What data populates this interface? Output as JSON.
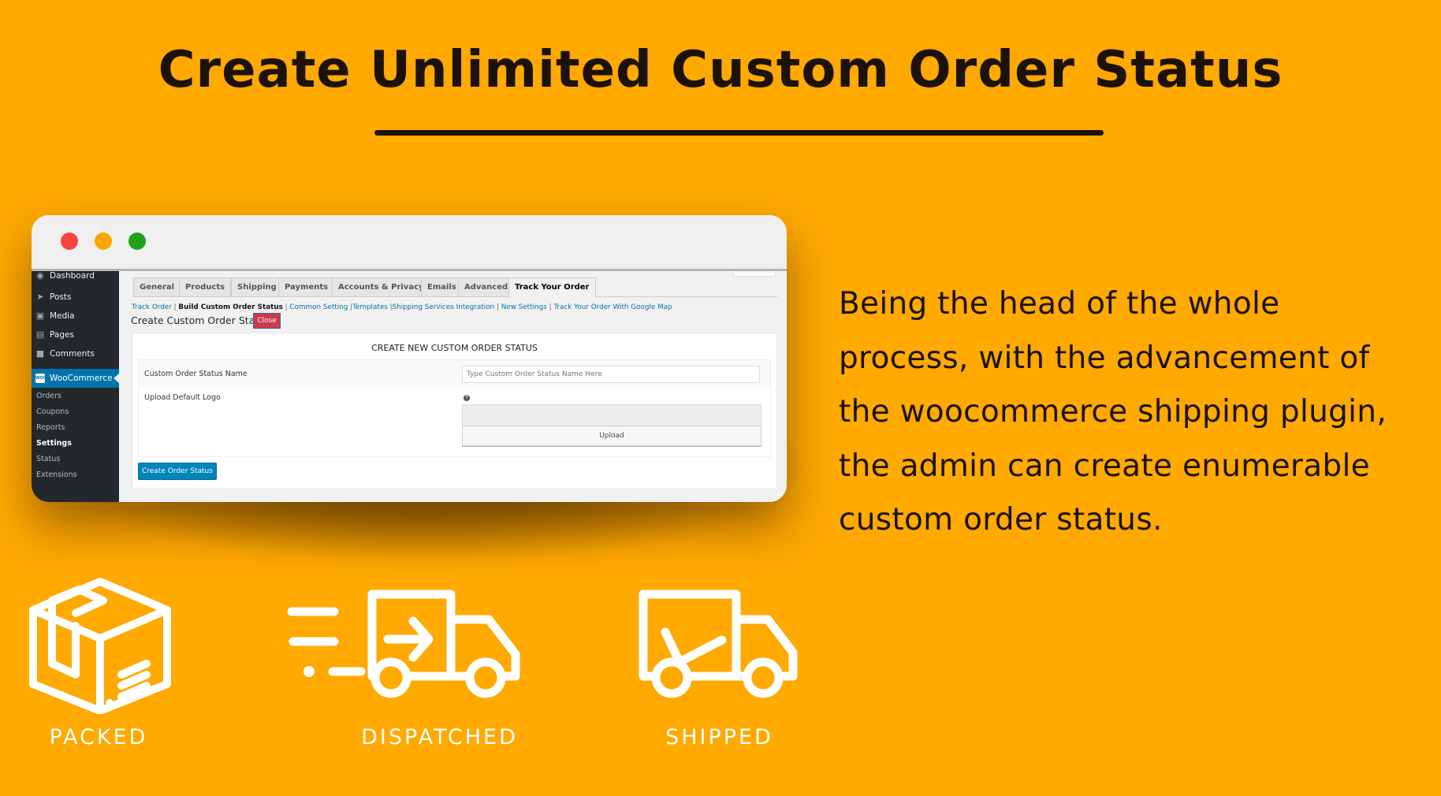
{
  "hero": {
    "title": "Create Unlimited Custom Order Status",
    "description": "Being the head of the whole process, with the advancement of the woocommerce shipping plugin, the admin can create enumerable custom order status.",
    "description_lines": [
      "Being the head of the whole",
      "process, with the advancement of",
      "the woocommerce shipping plugin,",
      "the admin can create enumerable",
      "custom order status."
    ]
  },
  "colors": {
    "background": "#ffa901",
    "title_text": "#1c1208",
    "wp_sidebar": "#23282d",
    "wp_accent": "#0073aa",
    "close_button": "#d1364f",
    "primary_button": "#0085ba"
  },
  "window": {
    "controls": [
      "close",
      "minimize",
      "maximize"
    ]
  },
  "sidebar": {
    "items": [
      {
        "label": "Dashboard",
        "icon": "dashboard-icon"
      },
      {
        "label": "Posts",
        "icon": "pin-icon"
      },
      {
        "label": "Media",
        "icon": "media-icon"
      },
      {
        "label": "Pages",
        "icon": "pages-icon"
      },
      {
        "label": "Comments",
        "icon": "comment-icon"
      },
      {
        "label": "WooCommerce",
        "icon": "woo-icon",
        "icon_text": "WOO"
      }
    ],
    "submenu": [
      {
        "label": "Orders"
      },
      {
        "label": "Coupons"
      },
      {
        "label": "Reports"
      },
      {
        "label": "Settings"
      },
      {
        "label": "Status"
      },
      {
        "label": "Extensions"
      }
    ]
  },
  "tabs": [
    {
      "label": "General"
    },
    {
      "label": "Products"
    },
    {
      "label": "Shipping"
    },
    {
      "label": "Payments"
    },
    {
      "label": "Accounts & Privacy"
    },
    {
      "label": "Emails"
    },
    {
      "label": "Advanced"
    },
    {
      "label": "Track Your Order"
    }
  ],
  "active_tab": "Track Your Order",
  "subnav": [
    {
      "label": "Track Order"
    },
    {
      "label": "Build Custom Order Status"
    },
    {
      "label": "Common Setting"
    },
    {
      "label": "Templates"
    },
    {
      "label": "Shipping Services Integration"
    },
    {
      "label": "New Settings"
    },
    {
      "label": "Track Your Order With Google Map"
    }
  ],
  "active_subnav": "Build Custom Order Status",
  "separator": "|",
  "page": {
    "heading": "Create Custom Order Status",
    "close_label": "Close",
    "panel_title": "CREATE NEW CUSTOM ORDER STATUS",
    "name_label": "Custom Order Status Name",
    "name_value": "",
    "name_placeholder": "Type Custom Order Status Name Here",
    "logo_label": "Upload Default Logo",
    "help_glyph": "?",
    "upload_label": "Upload",
    "create_label": "Create Order Status"
  },
  "statuses": [
    {
      "label": "PACKED",
      "icon": "package-box-icon"
    },
    {
      "label": "DISPATCHED",
      "icon": "fast-delivery-truck-icon"
    },
    {
      "label": "SHIPPED",
      "icon": "truck-checkmark-icon"
    }
  ]
}
